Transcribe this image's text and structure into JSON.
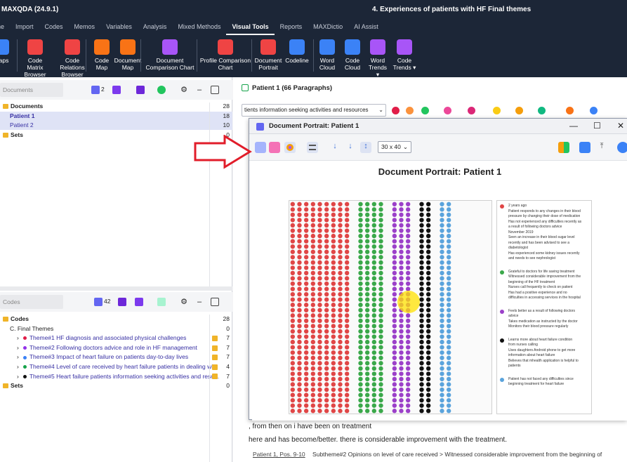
{
  "app": {
    "title": "MAXQDA (24.9.1)",
    "project": "4. Experiences of patients with HF Final themes"
  },
  "menu": [
    "Home",
    "Import",
    "Codes",
    "Memos",
    "Variables",
    "Analysis",
    "Mixed Methods",
    "Visual Tools",
    "Reports",
    "MAXDictio",
    "AI Assist"
  ],
  "menu_active": "Visual Tools",
  "ribbon": [
    {
      "l1": "Maps",
      "l2": "",
      "color": "#3b82f6"
    },
    {
      "l1": "Code Matrix",
      "l2": "Browser",
      "color": "#ef4444"
    },
    {
      "l1": "Code Relations",
      "l2": "Browser",
      "color": "#ef4444"
    },
    {
      "l1": "Code",
      "l2": "Map",
      "color": "#f97316"
    },
    {
      "l1": "Document",
      "l2": "Map",
      "color": "#f97316"
    },
    {
      "l1": "Document",
      "l2": "Comparison Chart",
      "color": "#a855f7"
    },
    {
      "l1": "Profile Comparison",
      "l2": "Chart",
      "color": "#ef4444"
    },
    {
      "l1": "Document",
      "l2": "Portrait",
      "color": "#ef4444"
    },
    {
      "l1": "Codeline",
      "l2": "",
      "color": "#3b82f6"
    },
    {
      "l1": "Word",
      "l2": "Cloud",
      "color": "#3b82f6"
    },
    {
      "l1": "Code",
      "l2": "Cloud",
      "color": "#3b82f6"
    },
    {
      "l1": "Word",
      "l2": "Trends ▾",
      "color": "#a855f7"
    },
    {
      "l1": "Code",
      "l2": "Trends ▾",
      "color": "#a855f7"
    }
  ],
  "documents_panel": {
    "search_placeholder": "Documents",
    "doc_count_badge": "2",
    "rows": [
      {
        "label": "Documents",
        "count": "28",
        "bold": true,
        "selected": false,
        "indent": 0
      },
      {
        "label": "Patient 1",
        "count": "18",
        "bold": true,
        "selected": true,
        "indent": 1
      },
      {
        "label": "Patient 2",
        "count": "10",
        "bold": false,
        "selected": true,
        "indent": 1
      },
      {
        "label": "Sets",
        "count": "0",
        "bold": true,
        "selected": false,
        "indent": 0
      }
    ]
  },
  "codes_panel": {
    "search_placeholder": "Codes",
    "code_count_badge": "42",
    "rows": [
      {
        "label": "Codes",
        "count": "28",
        "bold": true,
        "dot": "",
        "indent": 0
      },
      {
        "label": "C. Final Themes",
        "count": "0",
        "bold": false,
        "dot": "",
        "indent": 1
      },
      {
        "label": "Theme#1 HF diagnosis and associated physical challenges",
        "count": "7",
        "bold": false,
        "dot": "#e11d48",
        "indent": 2
      },
      {
        "label": "Theme#2 Following doctors advice and role in HF management",
        "count": "7",
        "bold": false,
        "dot": "#9333ea",
        "indent": 2
      },
      {
        "label": "Theme#3 Impact of heart failure on patients day-to-day lives",
        "count": "7",
        "bold": false,
        "dot": "#3b82f6",
        "indent": 2
      },
      {
        "label": "Theme#4 Level of care received  by heart failure patients in  dealing wi...",
        "count": "4",
        "bold": false,
        "dot": "#16a34a",
        "indent": 2
      },
      {
        "label": "Theme#5 Heart failure patients information seeking activities and reso...",
        "count": "7",
        "bold": false,
        "dot": "#111111",
        "indent": 2
      },
      {
        "label": "Sets",
        "count": "0",
        "bold": true,
        "dot": "",
        "indent": 0
      }
    ]
  },
  "document_browser": {
    "title": "Patient 1   (66 Paragraphs)",
    "combo": "tients information seeking activities and resources",
    "text_line_1": ", from then on i have been on treatment",
    "text_line_2": "here and has become/better. there is considerable improvement with the treatment.",
    "footer_link": "Patient 1, Pos. 9-10",
    "footer_text": "Subtheme#2 Opinions on level of care received > Witnessed considerable improvement from the beginning of"
  },
  "portrait_window": {
    "title": "Document Portrait: Patient 1",
    "size_option": "30 x 40",
    "size_chevron": "⌄"
  },
  "chart_data": {
    "type": "table",
    "title": "Document Portrait: Patient 1",
    "grid": {
      "columns": 30,
      "rows": 40
    },
    "note_bands": "Columns of colored dots (left to right) representing coded segments in document order",
    "bands": [
      {
        "color": "#e04646",
        "columns": 9,
        "full_rows": 40
      },
      {
        "color": "#ffffff",
        "columns": 1,
        "full_rows": 40
      },
      {
        "color": "#3aa84a",
        "columns": 4,
        "full_rows": 40
      },
      {
        "color": "#ffffff",
        "columns": 1,
        "full_rows": 40
      },
      {
        "color": "#9b40c9",
        "columns": 3,
        "full_rows": 40
      },
      {
        "color": "#ffffff",
        "columns": 1,
        "full_rows": 40
      },
      {
        "color": "#111111",
        "columns": 2,
        "full_rows": 40
      },
      {
        "color": "#ffffff",
        "columns": 1,
        "full_rows": 40
      },
      {
        "color": "#5aa3dc",
        "columns": 2,
        "full_rows": 40
      }
    ],
    "legend": [
      {
        "color": "#e04646",
        "lines": [
          "2 years ago",
          "Patient responds to any changes in their blood",
          "pressure by changing their dose of medication",
          "Has not experienced any difficulties recently as",
          "a result of following doctors advice",
          "November 2019",
          "Seen an increase in their blood sugar level",
          "recently and has been advised to see a",
          "diabetologist",
          "Has experienced some kidney issues recently",
          "and needs to see nephrologist"
        ]
      },
      {
        "color": "#3aa84a",
        "lines": [
          "Grateful to doctors for life saving treatment",
          "Witnessed considerable improvement from the",
          "beginning of the HF treatment",
          "Nurses call frequently to check on patient",
          "Has had a positive experience and no",
          "difficulties in accessing services in the hospital"
        ]
      },
      {
        "color": "#9b40c9",
        "lines": [
          "Feels better as a result of following doctors",
          "advice",
          "Takes medication as instructed by the doctor",
          "Monitors their blood pressure regularly"
        ]
      },
      {
        "color": "#111111",
        "lines": [
          "Learns more about heart failure condition",
          "from nurses calling",
          "Uses daughters Android phone to get more",
          "information about heart failure",
          "Believes that mhealth application is helpful to",
          "patients"
        ]
      },
      {
        "color": "#5aa3dc",
        "lines": [
          "Patient has not faced any difficulties since",
          "beginning treatment for heart failure"
        ]
      }
    ]
  }
}
